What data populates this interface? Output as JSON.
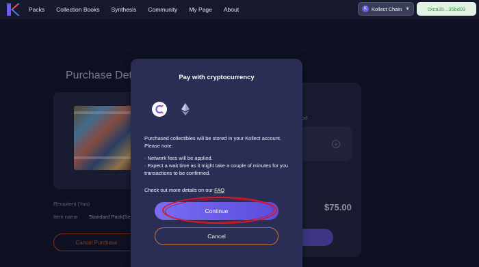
{
  "nav": {
    "items": [
      "Packs",
      "Collection Books",
      "Synthesis",
      "Community",
      "My Page",
      "About"
    ],
    "chain_label": "Kollect Chain",
    "wallet_address": "0xca35...35bd09"
  },
  "background": {
    "page_title": "Purchase Deta",
    "recipient_label": "Recipitent (You)",
    "item_name_label": "Item name",
    "item_name_value": "Standard Pack(Sea",
    "cancel_purchase_label": "Cancel Purchase",
    "method_text": "od",
    "price": "$75.00"
  },
  "modal": {
    "title": "Pay with cryptocurrency",
    "payment_options": [
      "kollect",
      "ethereum"
    ],
    "intro_text": "Purchased collectibles will be stored in your Kollect account. Please note:",
    "note_fees": "· Network fees will be applied.",
    "note_wait": "· Expect a wait time as it might take a couple of minutes for you transactions to be confirmed.",
    "faq_prefix": "Check out more details on our ",
    "faq_link": "FAQ",
    "continue_label": "Continue",
    "cancel_label": "Cancel"
  },
  "colors": {
    "accent": "#6a5ce8",
    "highlight": "#d5182a",
    "wallet_text": "#3f9a4a"
  }
}
